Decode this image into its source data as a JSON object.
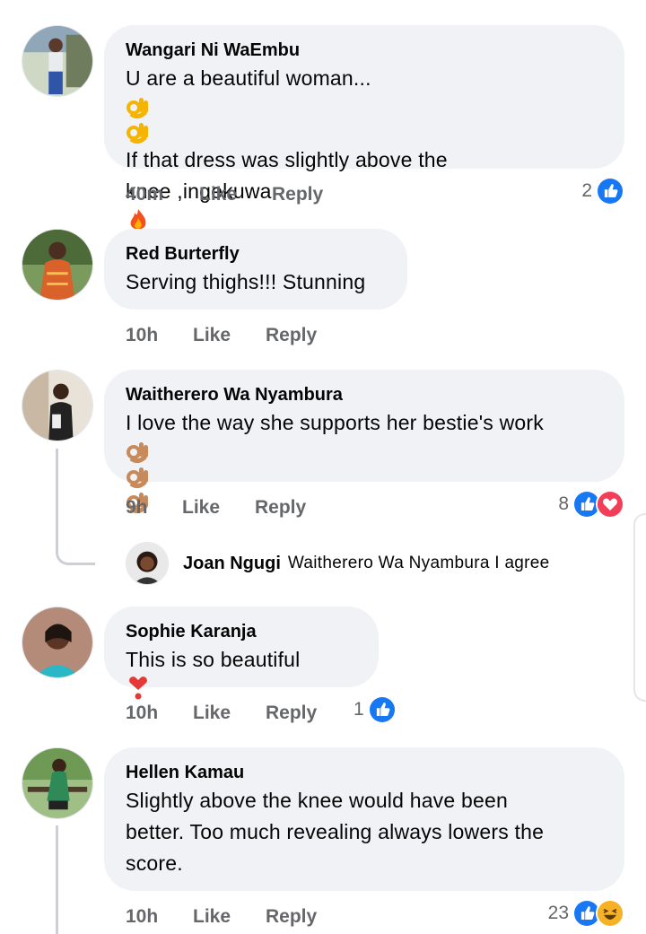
{
  "comments": [
    {
      "author": "Wangari Ni WaEmbu",
      "lines": [
        "U are a beautiful woman...",
        "If that dress was slightly above the",
        "knee ,ingekuwa"
      ],
      "emoji": [
        "ok-hand-emoji",
        "ok-hand-emoji",
        "fire-emoji"
      ],
      "time": "40m",
      "like": "Like",
      "reply": "Reply",
      "reaction_count": "2",
      "reactions": [
        "like"
      ]
    },
    {
      "author": "Red Burterfly",
      "lines": [
        "Serving thighs!!! Stunning"
      ],
      "time": "10h",
      "like": "Like",
      "reply": "Reply"
    },
    {
      "author": "Waitherero Wa Nyambura",
      "lines": [
        "I love the way she supports her bestie's work"
      ],
      "time": "9h",
      "like": "Like",
      "reply": "Reply",
      "reaction_count": "8",
      "reactions": [
        "like",
        "love"
      ]
    },
    {
      "author": "Sophie Karanja",
      "lines": [
        "This is so beautiful"
      ],
      "time": "10h",
      "like": "Like",
      "reply": "Reply",
      "reaction_count": "1",
      "reactions": [
        "like"
      ]
    },
    {
      "author": "Hellen Kamau",
      "lines": [
        "Slightly above the knee would have been",
        "better. Too much revealing always lowers the",
        "score."
      ],
      "time": "10h",
      "like": "Like",
      "reply": "Reply",
      "reaction_count": "23",
      "reactions": [
        "like",
        "haha"
      ]
    }
  ],
  "reply_preview": {
    "author": "Joan Ngugi",
    "text": "Waitherero Wa Nyambura I agree"
  },
  "colors": {
    "bubble": "#f0f2f5",
    "meta_text": "#65676b",
    "like_blue": "#1877f2",
    "love_red": "#f33e58",
    "haha_yellow": "#f7b125",
    "thread_line": "#ccd0d5"
  }
}
